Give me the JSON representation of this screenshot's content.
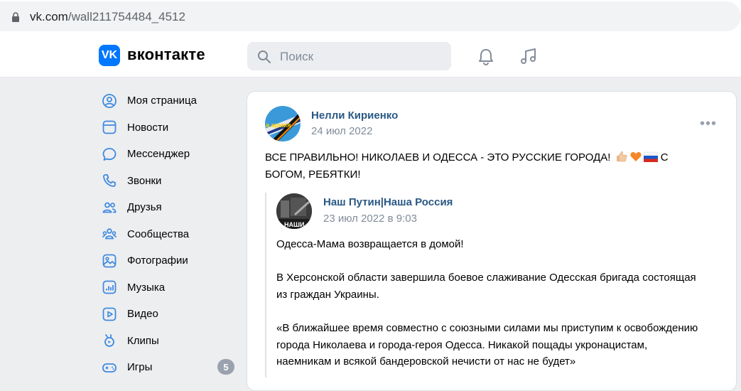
{
  "browser": {
    "url_host": "vk.com",
    "url_path": "/wall211754484_4512"
  },
  "header": {
    "brand": "вконтакте",
    "logo_text": "VK",
    "search_placeholder": "Поиск"
  },
  "sidebar": {
    "items": [
      {
        "label": "Моя страница",
        "icon": "profile-icon"
      },
      {
        "label": "Новости",
        "icon": "news-icon"
      },
      {
        "label": "Мессенджер",
        "icon": "messenger-icon"
      },
      {
        "label": "Звонки",
        "icon": "phone-icon"
      },
      {
        "label": "Друзья",
        "icon": "friends-icon"
      },
      {
        "label": "Сообщества",
        "icon": "communities-icon"
      },
      {
        "label": "Фотографии",
        "icon": "photos-icon"
      },
      {
        "label": "Музыка",
        "icon": "music-icon"
      },
      {
        "label": "Видео",
        "icon": "video-icon"
      },
      {
        "label": "Клипы",
        "icon": "clips-icon"
      },
      {
        "label": "Игры",
        "icon": "games-icon",
        "badge": "5"
      }
    ]
  },
  "post": {
    "author": "Нелли Кириенко",
    "date": "24 июл 2022",
    "avatar_text": "а армия",
    "text": "ВСЕ ПРАВИЛЬНО! НИКОЛАЕВ И ОДЕССА - ЭТО РУССКИЕ ГОРОДА!",
    "text_line2": "С БОГОМ, РЕБЯТКИ!",
    "repost": {
      "author": "Наш Путин|Наша Россия",
      "date": "23 июл 2022 в 9:03",
      "avatar_text": "НАШИ",
      "paragraphs": [
        "Одесса-Мама возвращается в домой!",
        "В Херсонской области завершила боевое слаживание Одесская бригада состоящая из граждан Украины.",
        "«В ближайшее время совместно с союзными силами мы приступим к освобождению города Николаева и города-героя Одесса. Никакой пощады укронацистам, наемникам и всякой бандеровской нечисти от нас не будет»"
      ]
    }
  },
  "colors": {
    "accent": "#0077ff",
    "link": "#2a5885",
    "muted": "#818c99",
    "background": "#edeef0"
  }
}
